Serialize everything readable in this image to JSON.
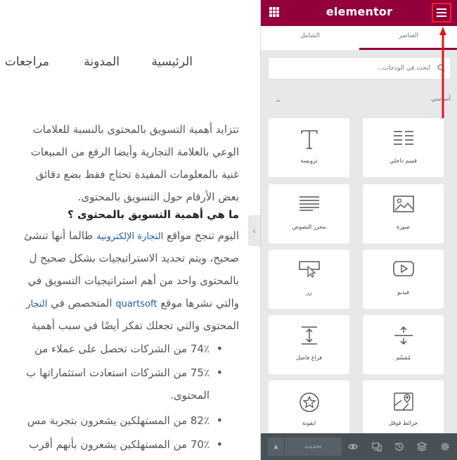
{
  "preview": {
    "nav": {
      "home": "الرئيسية",
      "blog": "المدونة",
      "reviews": "مراجعات"
    },
    "article": {
      "lines": [
        "تتزايد أهمية التسويق بالمحتوى بالنسبة للعلامات",
        "الوعي بالعلامة التجارية وأيضا الرفع من المبيعات",
        "غنية بالمعلومات المفيدة تحتاج فقط بضع دقائق",
        "بعض الأرقام حول التسويق بالمحتوى."
      ],
      "heading": "ما هي أهمية التسويق بالمحتوى ؟",
      "p2_start": "اليوم تنجح مواقع ",
      "p2_link": "التجارة الإلكترونية",
      "p2_end": " طالما أنها تنشئ",
      "p2_line2": "صحيح، ويتم تحديد الاستراتيجيات بشكل صحيح ل",
      "p2_line3": "بالمحتوى واحد من أهم استراتيجيات التسويق في",
      "p2_line4_start": "والتي نشرها موقع ",
      "p2_line4_link": "quartsoft",
      "p2_line4_mid": " المتخصص في ",
      "p2_line4_link2": "التجار",
      "p2_line5": "المحتوى والتي تجعلك تفكر أيضًا في سبب أهمية",
      "bullets": [
        "74٪ من الشركات تحصل على عملاء من",
        "75٪ من الشركات استعادت استثماراتها ب",
        "82٪ من المستهلكين يشعرون بتجربة مس",
        "70٪ من المستهلكين يشعرون بأنهم أقرب"
      ],
      "bullet2_cont": "المحتوى."
    },
    "collapse_icon": "chevron-left-icon"
  },
  "panel": {
    "logo": "elementor",
    "tabs": {
      "elements": "العناصر",
      "global": "الشامل"
    },
    "search_placeholder": "ابحث في الودجات...",
    "category_title": "أساسي",
    "widgets": [
      {
        "label": "قسم داخلي",
        "icon": "inner-section-icon"
      },
      {
        "label": "ترويسة",
        "icon": "heading-icon"
      },
      {
        "label": "صورة",
        "icon": "image-icon"
      },
      {
        "label": "محرر النصوص",
        "icon": "text-editor-icon"
      },
      {
        "label": "فيديو",
        "icon": "video-icon"
      },
      {
        "label": "زر",
        "icon": "button-icon"
      },
      {
        "label": "مُقسّم",
        "icon": "divider-icon"
      },
      {
        "label": "فراغ فاصل",
        "icon": "spacer-icon"
      },
      {
        "label": "خرائط قوقل",
        "icon": "google-maps-icon"
      },
      {
        "label": "ايقونة",
        "icon": "star-icon"
      }
    ],
    "footer": {
      "update_label": "تحديث"
    },
    "colors": {
      "brand": "#93003c",
      "panel_bg": "#e6e8ea",
      "footer_bg": "#495157",
      "highlight": "#ff1f1f"
    }
  }
}
